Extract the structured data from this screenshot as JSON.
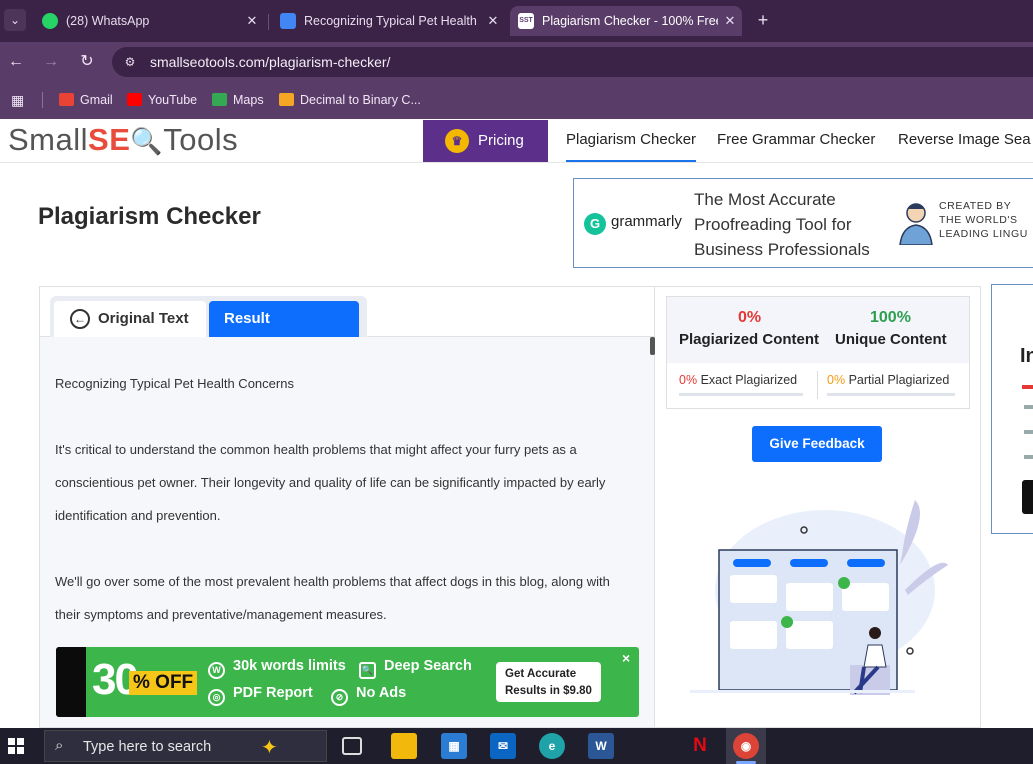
{
  "browser": {
    "tabs": [
      {
        "title": "(28) WhatsApp",
        "favicon": "whatsapp-icon",
        "color": "#25d366"
      },
      {
        "title": "Recognizing Typical Pet Health",
        "favicon": "google-docs-icon",
        "color": "#4285f4"
      },
      {
        "title": "Plagiarism Checker - 100% Free",
        "favicon": "sst-icon",
        "color": "#ffffff",
        "active": true
      }
    ],
    "new_tab_label": "+",
    "url": "smallseotools.com/plagiarism-checker/",
    "bookmarks": [
      {
        "label": "Gmail",
        "icon": "gmail-icon",
        "color": "#ea4335"
      },
      {
        "label": "YouTube",
        "icon": "youtube-icon",
        "color": "#ff0000"
      },
      {
        "label": "Maps",
        "icon": "maps-icon",
        "color": "#34a853"
      },
      {
        "label": "Decimal to Binary C...",
        "icon": "r-icon",
        "color": "#f5a623"
      }
    ]
  },
  "site": {
    "logo_left": "Small",
    "logo_mid": "SE",
    "logo_right": "Tools",
    "pricing": "Pricing",
    "nav": [
      "Plagiarism Checker",
      "Free Grammar Checker",
      "Reverse Image Sea"
    ],
    "page_title": "Plagiarism Checker"
  },
  "top_ad": {
    "brand": "grammarly",
    "tagline": "The Most Accurate Proofreading Tool for Business Professionals",
    "created": [
      "CREATED BY",
      "THE WORLD'S",
      "LEADING LINGU"
    ]
  },
  "editor": {
    "tab_original": "Original Text",
    "tab_result": "Result",
    "paragraphs": [
      "Recognizing Typical Pet Health Concerns",
      "It's critical to understand the common health problems that might affect your furry pets as a conscientious pet owner. Their longevity and quality of life can be significantly impacted by early identification and prevention.",
      "We'll go over some of the most prevalent health problems that affect dogs in this blog, along with their symptoms and preventative/management measures."
    ]
  },
  "promo": {
    "discount": "30",
    "off": "% OFF",
    "features": [
      "30k words limits",
      "Deep Search",
      "PDF Report",
      "No Ads"
    ],
    "cta": "Get Accurate Results in $9.80",
    "close": "×"
  },
  "results": {
    "plagiarized_pct": "0%",
    "plagiarized_label": "Plagiarized Content",
    "unique_pct": "100%",
    "unique_label": "Unique Content",
    "exact_pct": "0%",
    "exact_label": "Exact Plagiarized",
    "partial_pct": "0%",
    "partial_label": "Partial Plagiarized",
    "feedback": "Give Feedback",
    "colors": {
      "red": "#e53935",
      "green": "#2e9e4f",
      "orange": "#f39c12",
      "blue": "#0d6efd"
    }
  },
  "side_ad": {
    "text": "In"
  },
  "taskbar": {
    "search_placeholder": "Type here to search",
    "apps": [
      "task-view-icon",
      "file-explorer-icon",
      "store-icon",
      "mail-icon",
      "edge-icon",
      "word-icon",
      "netflix-icon",
      "chrome-icon"
    ]
  }
}
